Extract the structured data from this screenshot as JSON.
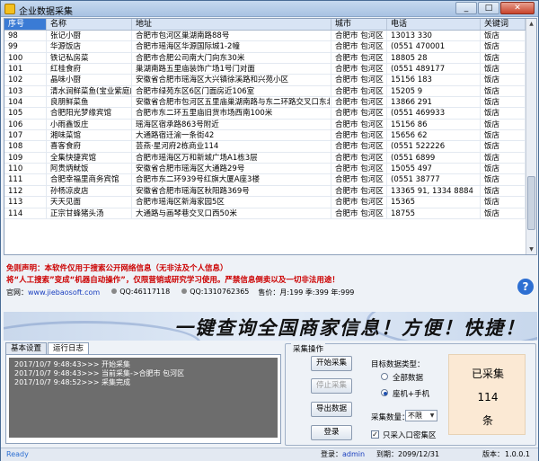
{
  "window": {
    "title": "企业数据采集",
    "min": "_",
    "max": "□",
    "close": "✕"
  },
  "table": {
    "headers": [
      "序号",
      "名称",
      "地址",
      "城市",
      "电话",
      "关键词"
    ],
    "rows": [
      [
        "98",
        "张记小厨",
        "合肥市包河区巢湖南路88号",
        "合肥市 包河区",
        "13013     330",
        "饭店"
      ],
      [
        "99",
        "华源饭店",
        "合肥市瑶海区华源国际城1-2幢",
        "合肥市 包河区",
        "(0551     470001",
        "饭店"
      ],
      [
        "100",
        "铁记私房菜",
        "合肥市合肥公司南大门向东30米",
        "合肥市 包河区",
        "18805     28",
        "饭店"
      ],
      [
        "101",
        "红桂食府",
        "巢湖南路五里庙装饰广场1号门对面",
        "合肥市 包河区",
        "(0551     489177",
        "饭店"
      ],
      [
        "102",
        "晶味小厨",
        "安徽省合肥市瑶海区大兴镇徐溪路和兴苑小区",
        "合肥市 包河区",
        "15156     183",
        "饭店"
      ],
      [
        "103",
        "清水涧鲜菜鱼(宝业紫庭店)",
        "合肥市绿苑东区6区门面房近106室",
        "合肥市 包河区",
        "15205     9",
        "饭店"
      ],
      [
        "104",
        "良朋鲜菜鱼",
        "安徽省合肥市包河区五里庙巢湖南路与东二环路交叉口东北4...",
        "合肥市 包河区",
        "13866     291",
        "饭店"
      ],
      [
        "105",
        "合肥阳光梦缘宾馆",
        "合肥市东二环五里庙旧货市场西南100米",
        "合肥市 包河区",
        "(0551     469933",
        "饭店"
      ],
      [
        "106",
        "小雨鑫饭庄",
        "瑶海区宿承路863号附近",
        "合肥市 包河区",
        "15156     86",
        "饭店"
      ],
      [
        "107",
        "湘味菜馆",
        "大通路宿迁渝一条街42",
        "合肥市 包河区",
        "15656     62",
        "饭店"
      ],
      [
        "108",
        "喜客食府",
        "芸燕·星河府2栋商业114",
        "合肥市 包河区",
        "(0551     522226",
        "饭店"
      ],
      [
        "109",
        "全集快捷宾馆",
        "合肥市瑶海区万和新城广场A1栋3层",
        "合肥市 包河区",
        "(0551     6899",
        "饭店"
      ],
      [
        "110",
        "阿贵炳鱿饭",
        "安徽省合肥市瑶海区大通路29号",
        "合肥市 包河区",
        "15055     497",
        "饭店"
      ],
      [
        "111",
        "合肥幸福里商务宾馆",
        "合肥市东二环939号红旗大厦A座3楼",
        "合肥市 包河区",
        "(0551     38777",
        "饭店"
      ],
      [
        "112",
        "孙杨凉皮店",
        "安徽省合肥市瑶海区秋阳路369号",
        "合肥市 包河区",
        "13365     91, 1334     8884",
        "饭店"
      ],
      [
        "113",
        "天天见面",
        "合肥市瑶海区新海家园5区",
        "合肥市 包河区",
        "15365     ",
        "饭店"
      ],
      [
        "114",
        "正宗甘蜂猪头汤",
        "大通路与画琴巷交叉口西50米",
        "合肥市 包河区",
        "18755     ",
        "饭店"
      ]
    ]
  },
  "banner": {
    "disclaimer1": "免则声明：本软件仅用于搜索公开网络信息（无非法及个人信息）",
    "disclaimer2": "将“人工搜索”变成“机器自动操作”，仅限营销或研究学习使用。严禁信息倒卖以及一切非法用途！",
    "site_label": "官网：",
    "site": "www.jiebaosoft.com",
    "qq1": "QQ:46117118",
    "qq2": "QQ:1310762365",
    "price": "售价：月:199  季:399  年:999"
  },
  "slogan": "一键查询全国商家信息！方便！快捷！",
  "tabs": [
    "基本设置",
    "运行日志"
  ],
  "log": [
    "2017/10/7 9:48:43>>> 开始采集",
    "2017/10/7 9:48:43>>> 当前采集->合肥市 包河区",
    "2017/10/7 9:48:52>>> 采集完成"
  ],
  "ops": {
    "legend": "采集操作",
    "start": "开始采集",
    "stop": "停止采集",
    "export": "导出数据",
    "login": "登录",
    "type_label": "目标数据类型：",
    "opt_all": "全部数据",
    "opt_phone": "座机+手机",
    "count_label": "采集数量：",
    "count_value": "不限",
    "only_dense": "只采入口密集区"
  },
  "counter": {
    "label": "已采集",
    "value": "114",
    "unit": "条"
  },
  "status": {
    "ready": "Ready",
    "login_label": "登录：",
    "user": "admin",
    "expire_label": "到期：",
    "expire": "2099/12/31",
    "version_label": "版本：",
    "version": "1.0.0.1"
  }
}
